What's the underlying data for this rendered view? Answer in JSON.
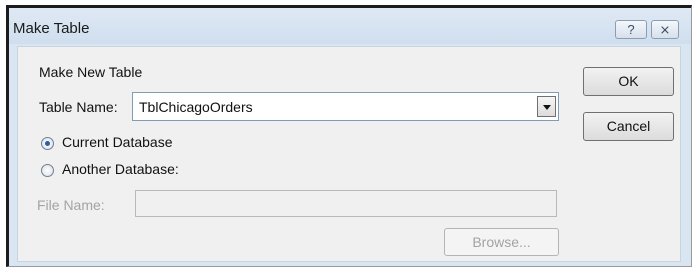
{
  "window": {
    "title": "Make Table",
    "help_label": "?",
    "close_label": "⨯"
  },
  "form": {
    "section_label": "Make New Table",
    "table_name_label": "Table Name:",
    "table_name_value": "TblChicagoOrders",
    "radio_current_label": "Current Database",
    "radio_another_label": "Another Database:",
    "selected_option": "Current Database",
    "file_name_label": "File Name:",
    "file_name_value": ""
  },
  "buttons": {
    "ok_label": "OK",
    "cancel_label": "Cancel",
    "browse_label": "Browse..."
  }
}
